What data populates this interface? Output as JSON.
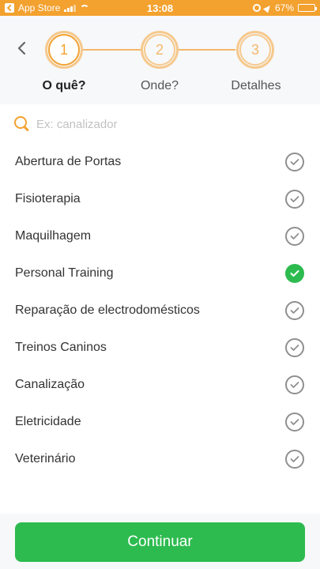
{
  "status_bar": {
    "back_app": "App Store",
    "time": "13:08",
    "battery": "67%",
    "icons": [
      "back-app-icon",
      "signal-icon",
      "wifi-icon",
      "rotation-lock-icon",
      "location-arrow-icon",
      "battery-icon"
    ]
  },
  "stepper": {
    "steps": [
      {
        "number": "1",
        "label": "O quê?",
        "active": true
      },
      {
        "number": "2",
        "label": "Onde?",
        "active": false
      },
      {
        "number": "3",
        "label": "Detalhes",
        "active": false
      }
    ]
  },
  "search": {
    "placeholder": "Ex: canalizador",
    "value": ""
  },
  "services": [
    {
      "label": "Abertura de Portas",
      "selected": false
    },
    {
      "label": "Fisioterapia",
      "selected": false
    },
    {
      "label": "Maquilhagem",
      "selected": false
    },
    {
      "label": "Personal Training",
      "selected": true
    },
    {
      "label": "Reparação de electrodomésticos",
      "selected": false
    },
    {
      "label": "Treinos Caninos",
      "selected": false
    },
    {
      "label": "Canalização",
      "selected": false
    },
    {
      "label": "Eletricidade",
      "selected": false
    },
    {
      "label": "Veterinário",
      "selected": false
    }
  ],
  "footer": {
    "continue_label": "Continuar"
  },
  "colors": {
    "accent": "#f3a12f",
    "success": "#2dbb4f",
    "header_bg": "#f7f8fa"
  }
}
